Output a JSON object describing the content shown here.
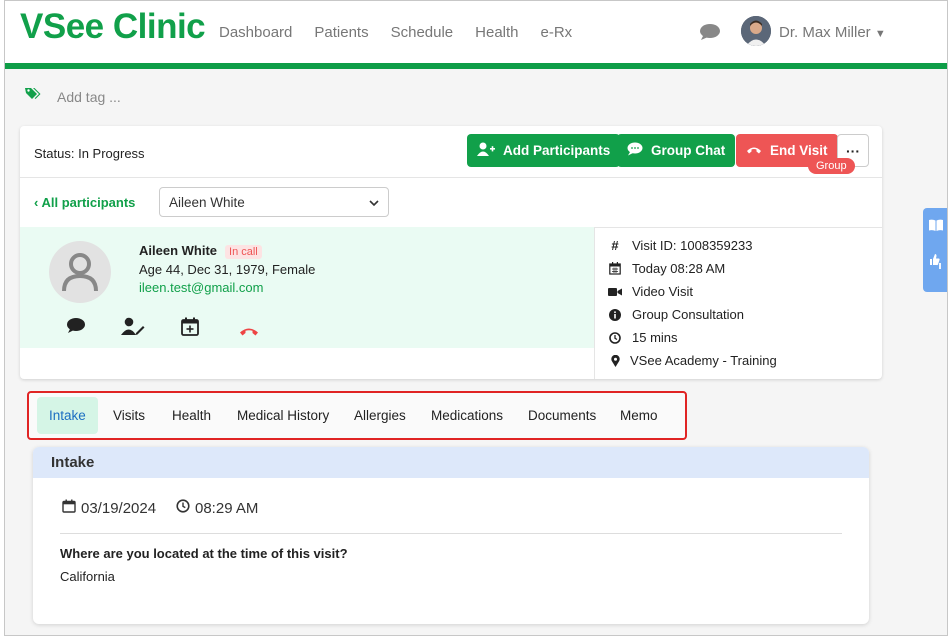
{
  "header": {
    "logo": "VSee Clinic",
    "nav": [
      "Dashboard",
      "Patients",
      "Schedule",
      "Health",
      "e-Rx"
    ],
    "user_name": "Dr. Max Miller",
    "brand_color": "#11a04a"
  },
  "tags": {
    "placeholder": "Add tag ..."
  },
  "visit": {
    "status": "Status: In Progress",
    "add_participants": "Add Participants",
    "group_chat": "Group Chat",
    "end_visit": "End Visit",
    "more": "···",
    "all_participants": "All participants",
    "participant_selected": "Aileen White"
  },
  "patient": {
    "name": "Aileen White",
    "badge": "In call",
    "info": "Age 44, Dec 31, 1979, Female",
    "email": "ileen.test@gmail.com"
  },
  "visit_info": {
    "id": "Visit ID: 1008359233",
    "time": "Today 08:28 AM",
    "type": "Video Visit",
    "type_badge": "Group",
    "reason": "Group Consultation",
    "duration": "15 mins",
    "location": "VSee Academy - Training"
  },
  "tabs": [
    "Intake",
    "Visits",
    "Health",
    "Medical History",
    "Allergies",
    "Medications",
    "Documents",
    "Memo"
  ],
  "intake": {
    "title": "Intake",
    "date": "03/19/2024",
    "time": "08:29 AM",
    "question": "Where are you located at the time of this visit?",
    "answer": "California"
  }
}
